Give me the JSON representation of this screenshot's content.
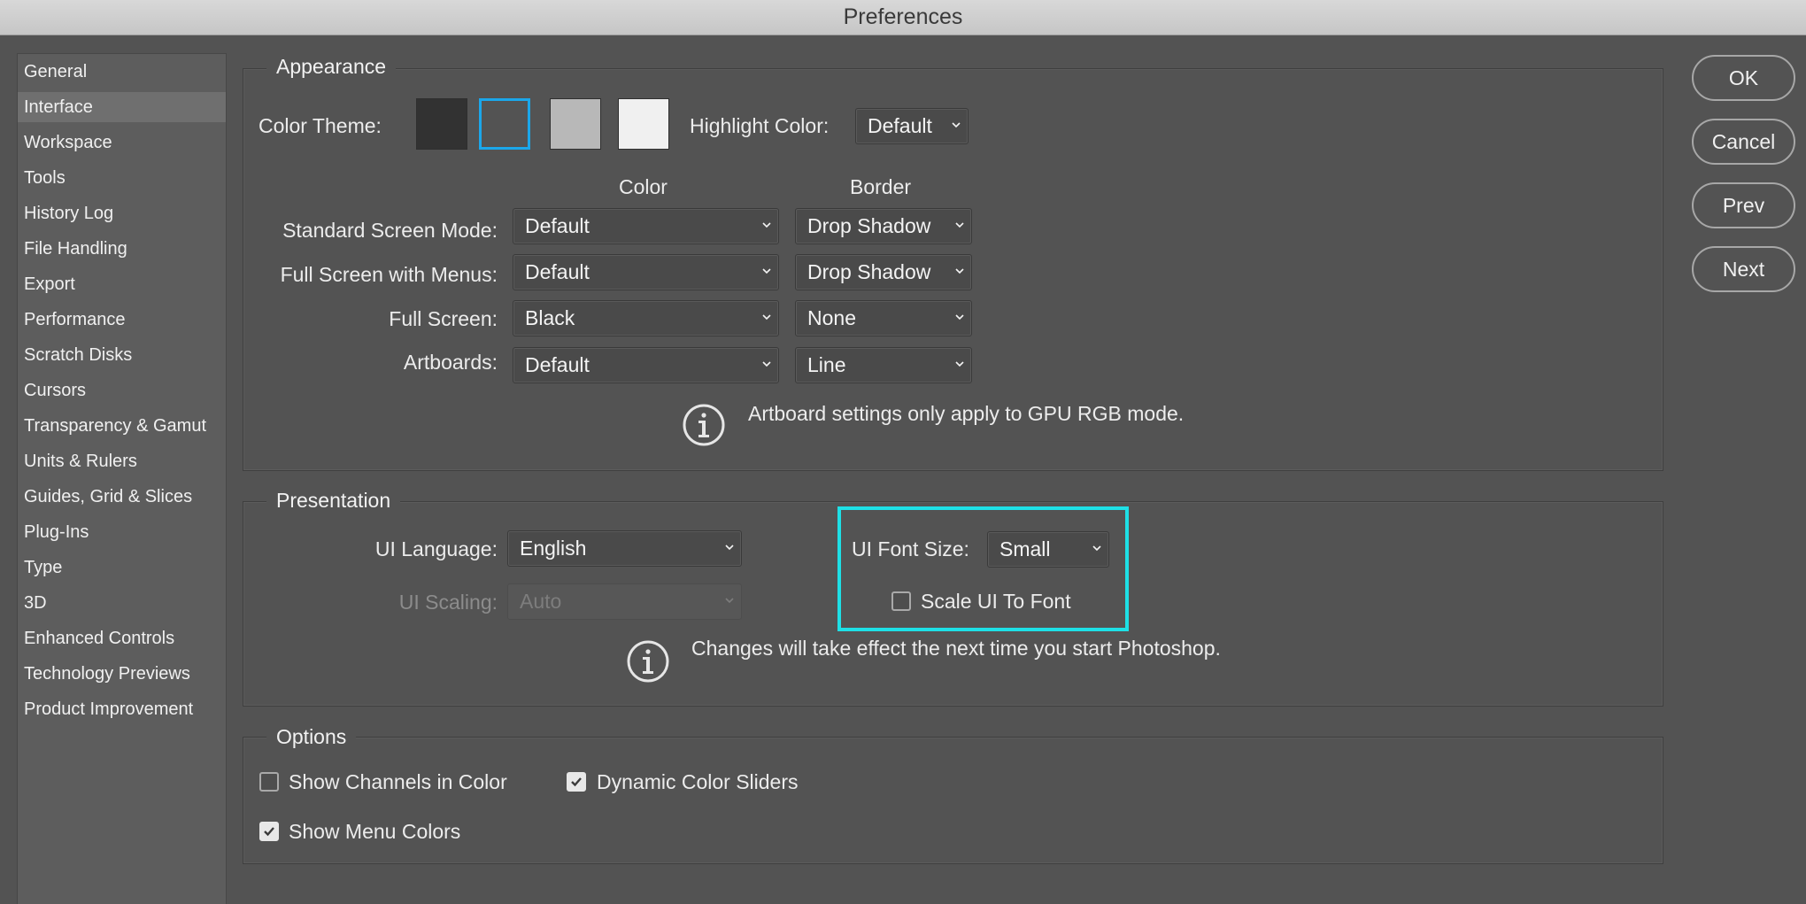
{
  "window": {
    "title": "Preferences"
  },
  "sidebar": {
    "selected_index": 1,
    "items": [
      {
        "label": "General"
      },
      {
        "label": "Interface"
      },
      {
        "label": "Workspace"
      },
      {
        "label": "Tools"
      },
      {
        "label": "History Log"
      },
      {
        "label": "File Handling"
      },
      {
        "label": "Export"
      },
      {
        "label": "Performance"
      },
      {
        "label": "Scratch Disks"
      },
      {
        "label": "Cursors"
      },
      {
        "label": "Transparency & Gamut"
      },
      {
        "label": "Units & Rulers"
      },
      {
        "label": "Guides, Grid & Slices"
      },
      {
        "label": "Plug-Ins"
      },
      {
        "label": "Type"
      },
      {
        "label": "3D"
      },
      {
        "label": "Enhanced Controls"
      },
      {
        "label": "Technology Previews"
      },
      {
        "label": "Product Improvement"
      }
    ]
  },
  "appearance": {
    "title": "Appearance",
    "color_theme_label": "Color Theme:",
    "theme_swatches": [
      {
        "color": "#323232"
      },
      {
        "color": "#535353",
        "selected": true
      },
      {
        "color": "#b8b8b8"
      },
      {
        "color": "#f0f0f0"
      }
    ],
    "highlight_color_label": "Highlight Color:",
    "highlight_color_value": "Default",
    "col_color": "Color",
    "col_border": "Border",
    "rows": [
      {
        "label": "Standard Screen Mode:",
        "color": "Default",
        "border": "Drop Shadow"
      },
      {
        "label": "Full Screen with Menus:",
        "color": "Default",
        "border": "Drop Shadow"
      },
      {
        "label": "Full Screen:",
        "color": "Black",
        "border": "None"
      },
      {
        "label": "Artboards:",
        "color": "Default",
        "border": "Line"
      }
    ],
    "info_text": "Artboard settings only apply to GPU RGB mode."
  },
  "presentation": {
    "title": "Presentation",
    "ui_language_label": "UI Language:",
    "ui_language_value": "English",
    "ui_scaling_label": "UI Scaling:",
    "ui_scaling_value": "Auto",
    "ui_font_size_label": "UI Font Size:",
    "ui_font_size_value": "Small",
    "scale_ui_to_font_label": "Scale UI To Font",
    "scale_ui_to_font_checked": false,
    "info_text": "Changes will take effect the next time you start Photoshop."
  },
  "options": {
    "title": "Options",
    "show_channels_label": "Show Channels in Color",
    "show_channels_checked": false,
    "dynamic_sliders_label": "Dynamic Color Sliders",
    "dynamic_sliders_checked": true,
    "show_menu_colors_label": "Show Menu Colors",
    "show_menu_colors_checked": true
  },
  "buttons": {
    "ok": "OK",
    "cancel": "Cancel",
    "prev": "Prev",
    "next": "Next"
  },
  "colors": {
    "accent_selection": "#1ba7ea",
    "annotation_highlight": "#1ee0e6"
  }
}
